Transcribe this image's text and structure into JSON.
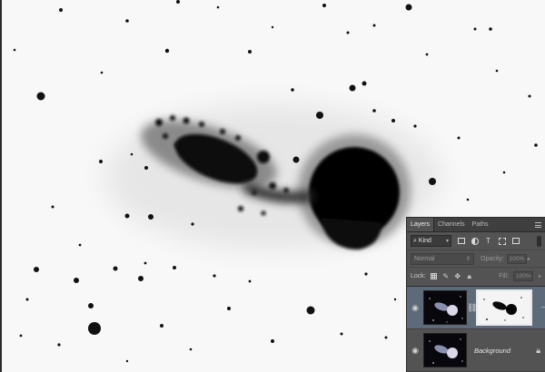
{
  "layers_panel": {
    "tabs": [
      {
        "label": "Layers",
        "active": true
      },
      {
        "label": "Channels",
        "active": false
      },
      {
        "label": "Paths",
        "active": false
      }
    ],
    "filter": {
      "kind_label": "Kind",
      "icons": [
        "image-filter-icon",
        "adjustment-filter-icon",
        "type-filter-icon",
        "shape-filter-icon",
        "smart-object-filter-icon"
      ]
    },
    "blend_mode": "Normal",
    "opacity_label": "Opacity:",
    "opacity_value": "100%",
    "lock_label": "Lock:",
    "lock_icons": [
      "lock-transparent-icon",
      "lock-pixels-icon",
      "lock-position-icon",
      "lock-all-icon"
    ],
    "fill_label": "Fill:",
    "fill_value": "100%",
    "layers": [
      {
        "name": "",
        "visible": true,
        "selected": true,
        "has_mask": true
      },
      {
        "name": "Background",
        "visible": true,
        "selected": false,
        "locked": true
      }
    ]
  },
  "colors": {
    "panel_bg": "#535353",
    "tab_bar_bg": "#3f3f3f",
    "selected_layer": "#5d6a7a",
    "canvas_bg": "#f8f8f8"
  }
}
